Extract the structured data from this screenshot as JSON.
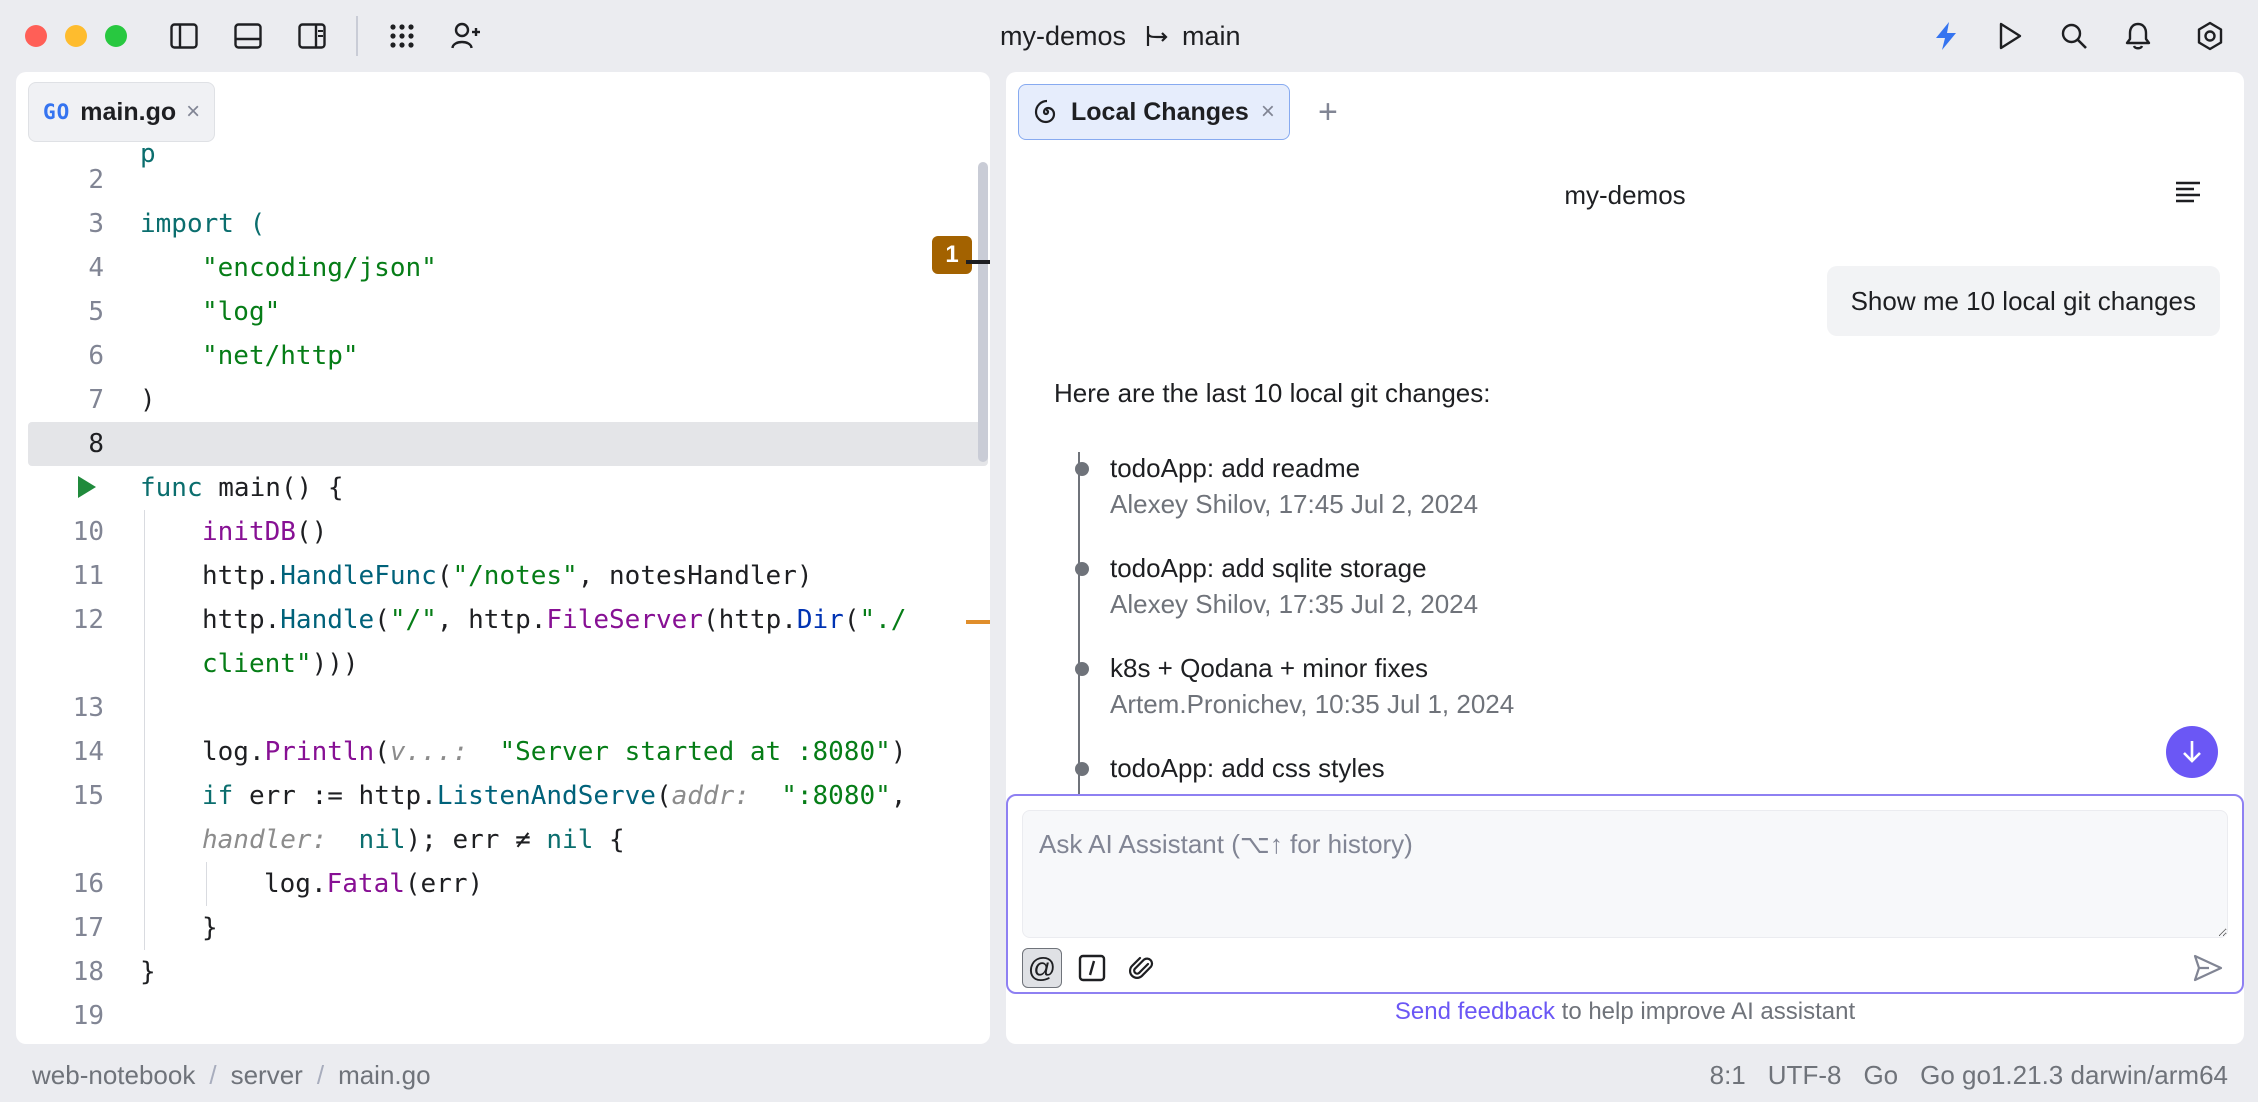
{
  "window": {
    "project": "my-demos",
    "branch": "main"
  },
  "toolbar": {
    "left_icons": [
      "sidebar-left-icon",
      "bottom-panel-icon",
      "sidebar-right-icon",
      "apps-grid-icon",
      "add-user-icon"
    ],
    "right_icons": [
      "lightning-icon",
      "run-icon",
      "search-icon",
      "bell-icon",
      "settings-icon"
    ],
    "accent": "#3574F0"
  },
  "editor": {
    "tab": {
      "badge": "GO",
      "label": "main.go",
      "close": "×"
    },
    "problem_count": "1",
    "lines": [
      {
        "num": "2",
        "text": ""
      },
      {
        "num": "3",
        "text": "import ("
      },
      {
        "num": "4",
        "text": "\"encoding/json\""
      },
      {
        "num": "5",
        "text": "\"log\""
      },
      {
        "num": "6",
        "text": "\"net/http\""
      },
      {
        "num": "7",
        "text": ")"
      },
      {
        "num": "8",
        "text": ""
      },
      {
        "num": "",
        "text": "func main() {"
      },
      {
        "num": "10",
        "text": "initDB()"
      },
      {
        "num": "11",
        "text": "http.HandleFunc(\"/notes\", notesHandler)"
      },
      {
        "num": "12",
        "text": "http.Handle(\"/\", http.FileServer(http.Dir(\"./"
      },
      {
        "num": "",
        "text": "client\")))"
      },
      {
        "num": "13",
        "text": ""
      },
      {
        "num": "14",
        "text": "log.Println(v...:  \"Server started at :8080\")"
      },
      {
        "num": "15",
        "text": "if err := http.ListenAndServe(addr:  \":8080\","
      },
      {
        "num": "",
        "text": "handler:  nil); err ≠ nil {"
      },
      {
        "num": "16",
        "text": "log.Fatal(err)"
      },
      {
        "num": "17",
        "text": "}"
      },
      {
        "num": "18",
        "text": "}"
      },
      {
        "num": "19",
        "text": ""
      }
    ]
  },
  "ai": {
    "tab_label": "Local Changes",
    "tab_close": "×",
    "add_tab": "+",
    "title": "my-demos",
    "user_message": "Show me 10 local git changes",
    "reply": "Here are the last 10 local git changes:",
    "commits": [
      {
        "message": "todoApp: add readme",
        "meta": "Alexey Shilov, 17:45 Jul 2, 2024"
      },
      {
        "message": "todoApp: add sqlite storage",
        "meta": "Alexey Shilov, 17:35 Jul 2, 2024"
      },
      {
        "message": "k8s + Qodana + minor fixes",
        "meta": "Artem.Pronichev, 10:35 Jul 1, 2024"
      },
      {
        "message": "todoApp: add css styles",
        "meta": ""
      }
    ],
    "input_placeholder": "Ask AI Assistant (⌥↑ for history)",
    "input_value": "",
    "at_button": "@",
    "feedback_link": "Send feedback",
    "feedback_rest": " to help improve AI assistant",
    "accent": "#6B57F5"
  },
  "statusbar": {
    "breadcrumbs": [
      "web-notebook",
      "server",
      "main.go"
    ],
    "position": "8:1",
    "encoding": "UTF-8",
    "language": "Go",
    "sdk": "Go go1.21.3 darwin/arm64"
  }
}
